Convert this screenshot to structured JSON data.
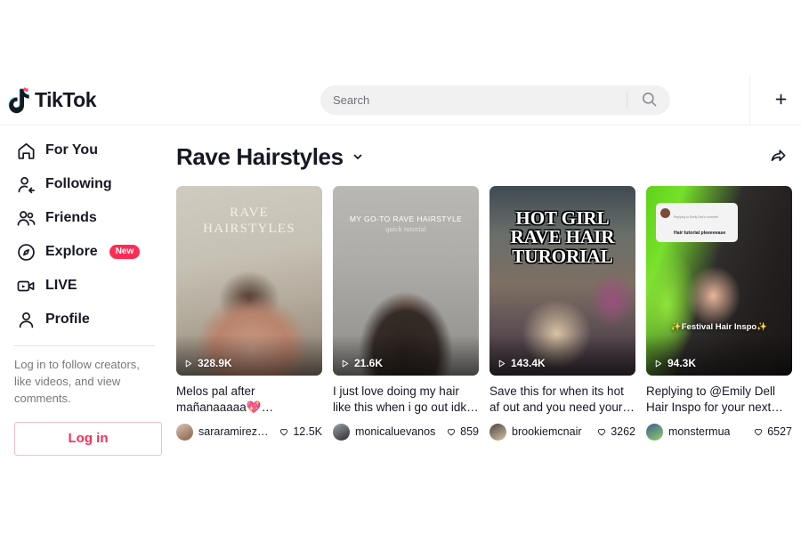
{
  "header": {
    "brand": "TikTok",
    "search": {
      "value": "",
      "placeholder": "Search"
    },
    "search_icon": "search-icon",
    "upload_label": "+"
  },
  "sidebar": {
    "items": [
      {
        "label": "For You",
        "icon": "home-icon",
        "badge": ""
      },
      {
        "label": "Following",
        "icon": "following-icon",
        "badge": ""
      },
      {
        "label": "Friends",
        "icon": "friends-icon",
        "badge": ""
      },
      {
        "label": "Explore",
        "icon": "compass-icon",
        "badge": "New"
      },
      {
        "label": "LIVE",
        "icon": "live-icon",
        "badge": ""
      },
      {
        "label": "Profile",
        "icon": "profile-icon",
        "badge": ""
      }
    ],
    "login_prompt": "Log in to follow creators, like videos, and view comments.",
    "login_button": "Log in"
  },
  "main": {
    "title": "Rave Hairstyles",
    "title_caret": "chevron-down-icon",
    "share_icon": "share-icon",
    "cards": [
      {
        "views": "328.9K",
        "title": "Melos pal after mañanaaaaa💖 #hairstyle…",
        "author": "sararamirezm…",
        "likes": "12.5K",
        "overlay_title": "RAVE HAIRSTYLES",
        "overlay_sub": ""
      },
      {
        "views": "21.6K",
        "title": "I just love doing my hair like this when i go out idk…",
        "author": "monicaluevanos",
        "likes": "859",
        "overlay_title": "MY GO-TO RAVE HAIRSTYLE",
        "overlay_sub": "quick tutorial"
      },
      {
        "views": "143.4K",
        "title": "Save this for when its hot af out and you need your…",
        "author": "brookiemcnair",
        "likes": "3262",
        "overlay_title": "HOT GIRL RAVE HAIR TURORIAL",
        "overlay_sub": ""
      },
      {
        "views": "94.3K",
        "title": "Replying to @Emily Dell Hair Inspo for your next…",
        "author": "monstermua",
        "likes": "6527",
        "overlay_title": "",
        "overlay_sub": "✨Festival Hair Inspo✨",
        "comment_header": "Replying to Emily Dell's comment",
        "comment_text": "Hair tutorial pleeeeease"
      }
    ]
  },
  "colors": {
    "accent": "#fe2c55",
    "text": "#161823",
    "muted": "#78787d",
    "field": "#f1f1f2"
  }
}
